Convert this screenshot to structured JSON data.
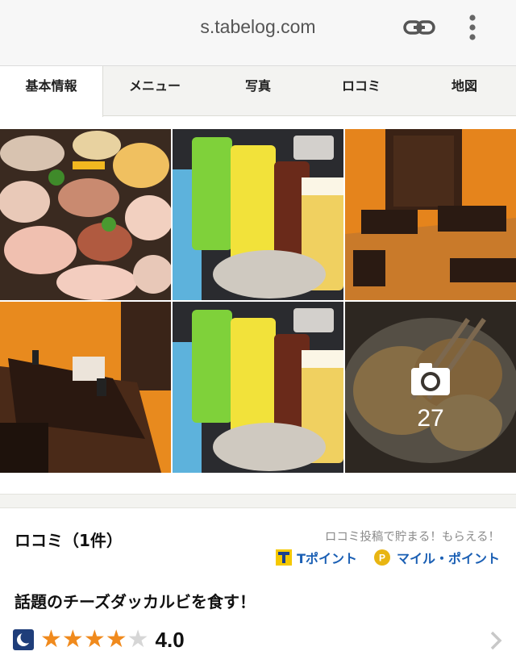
{
  "browser": {
    "url": "s.tabelog.com",
    "link_icon": "link-icon",
    "menu_icon": "more-vertical-icon"
  },
  "tabs": [
    {
      "label": "基本情報",
      "active": true
    },
    {
      "label": "メニュー",
      "active": false
    },
    {
      "label": "写真",
      "active": false
    },
    {
      "label": "ロコミ",
      "active": false
    },
    {
      "label": "地図",
      "active": false
    }
  ],
  "photos": {
    "items": [
      "food-platter-photo",
      "drinks-photo",
      "private-room-photo",
      "table-seating-photo",
      "drinks-photo-2",
      "fried-chicken-photo"
    ],
    "more_count": "27",
    "camera_icon": "camera-icon"
  },
  "reviews": {
    "title": "ロコミ（1件）",
    "promo": "ロコミ投稿で貯まる！もらえる！",
    "tpoint": "Tポイント",
    "mile": "マイル・ポイント",
    "headline": "話題のチーズダッカルビを食す！",
    "rating": {
      "value": "4.0",
      "stars_filled": 4,
      "stars_total": 5
    },
    "colors": {
      "star": "#f08a1d",
      "star_empty": "#d6d6d6",
      "link": "#1a5fb4"
    }
  }
}
